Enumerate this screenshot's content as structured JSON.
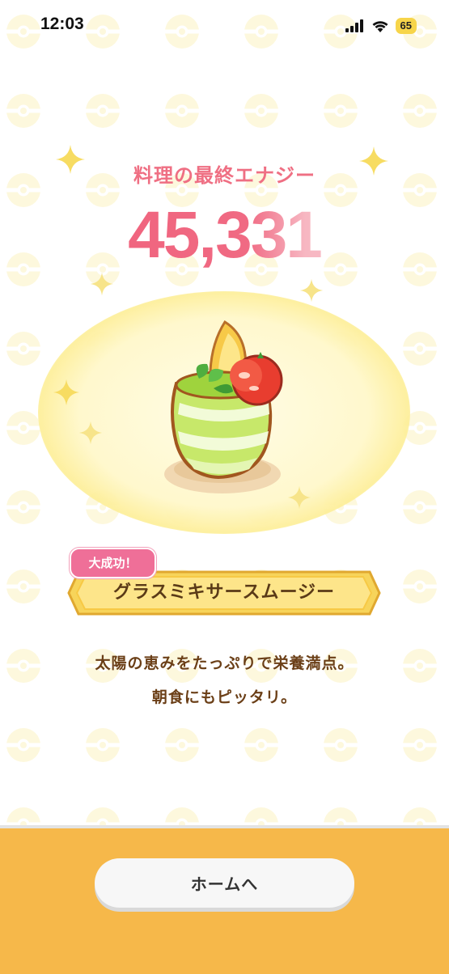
{
  "status_bar": {
    "time": "12:03",
    "battery": "65"
  },
  "energy": {
    "label": "料理の最終エナジー",
    "value": "45,331"
  },
  "dish": {
    "badge": "大成功！",
    "name": "グラスミキサースムージー",
    "description_line1": "太陽の恵みをたっぷりで栄養満点。",
    "description_line2": "朝食にもピッタリ。"
  },
  "footer": {
    "home_button": "ホームへ"
  },
  "colors": {
    "energy_pink": "#ef6f83",
    "ribbon_gold": "#f7d45a",
    "badge_pink": "#ef6f98",
    "footer_orange": "#f6b84a",
    "text_brown": "#6b3f17"
  }
}
